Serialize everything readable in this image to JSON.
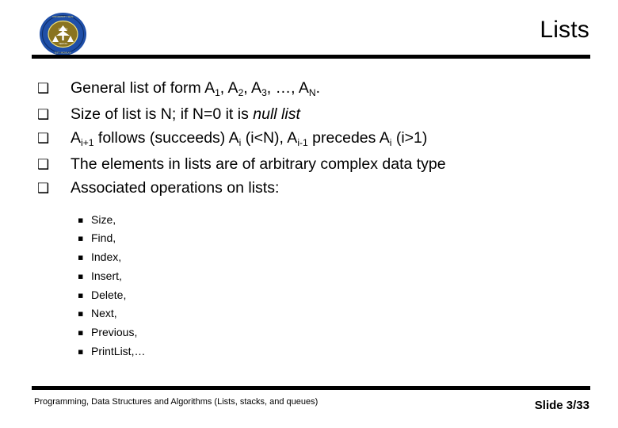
{
  "slide": {
    "title": "Lists",
    "background_color": "#ffffff",
    "text_color": "#000000",
    "rule_color": "#000000"
  },
  "logo": {
    "name": "university-seal-logo",
    "ring_color": "#1f4fa8",
    "center_color": "#8a7420",
    "ring_text_color": "#f3e27a",
    "emblem_color": "#ffffff"
  },
  "bullets": {
    "marker_glyph": "❑",
    "items": [
      {
        "id": "general-list",
        "segments": [
          {
            "type": "text",
            "value": "General list of form A"
          },
          {
            "type": "sub",
            "value": "1"
          },
          {
            "type": "text",
            "value": ", A"
          },
          {
            "type": "sub",
            "value": "2"
          },
          {
            "type": "text",
            "value": ", A"
          },
          {
            "type": "sub",
            "value": "3"
          },
          {
            "type": "text",
            "value": ", …, A"
          },
          {
            "type": "sub",
            "value": "N"
          },
          {
            "type": "text",
            "value": "."
          }
        ]
      },
      {
        "id": "size-of-list",
        "segments": [
          {
            "type": "text",
            "value": "Size of list is N; if N=0 it is "
          },
          {
            "type": "italic",
            "value": "null list"
          }
        ]
      },
      {
        "id": "order-relation",
        "segments": [
          {
            "type": "text",
            "value": "A"
          },
          {
            "type": "sub",
            "value": "i+1"
          },
          {
            "type": "text",
            "value": " follows (succeeds) A"
          },
          {
            "type": "sub",
            "value": "i"
          },
          {
            "type": "text",
            "value": " (i<N), A"
          },
          {
            "type": "sub",
            "value": "i-1"
          },
          {
            "type": "text",
            "value": " precedes A"
          },
          {
            "type": "sub",
            "value": "i"
          },
          {
            "type": "text",
            "value": " (i>1)"
          }
        ]
      },
      {
        "id": "element-type",
        "segments": [
          {
            "type": "text",
            "value": "The elements in lists are of arbitrary complex data type"
          }
        ]
      },
      {
        "id": "associated-operations",
        "segments": [
          {
            "type": "text",
            "value": "Associated operations on lists:"
          }
        ]
      }
    ]
  },
  "operations": {
    "marker_glyph": "▪",
    "items": [
      "Size,",
      "Find,",
      "Index,",
      "Insert,",
      "Delete,",
      "Next,",
      "Previous,",
      "PrintList,…"
    ]
  },
  "footer": {
    "text": "Programming, Data Structures and Algorithms  (Lists, stacks, and queues)",
    "slide_number": "Slide 3/33"
  }
}
